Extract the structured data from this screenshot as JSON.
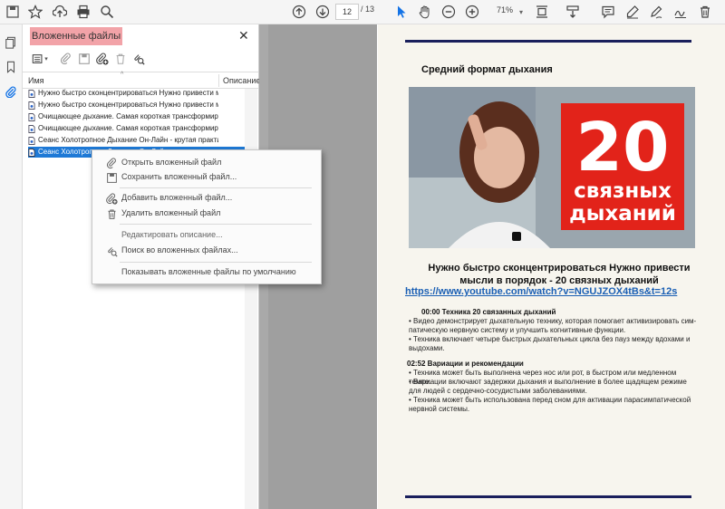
{
  "toolbar": {
    "page_current": "12",
    "page_total": "/ 13",
    "zoom": "71%",
    "icons": [
      "save-icon",
      "star-icon",
      "upload-icon",
      "print-icon",
      "zoom-search-icon",
      "prev-page-icon",
      "next-page-icon",
      "select-cursor-icon",
      "hand-icon",
      "zoom-out-icon",
      "zoom-in-icon",
      "fit-page-icon",
      "scroll-mode-icon",
      "comment-icon",
      "highlight-pen-icon",
      "draw-icon",
      "sign-icon",
      "delete-icon"
    ]
  },
  "attachments_panel": {
    "title": "Вложенные файлы",
    "col_name": "Имя",
    "col_desc": "Описание",
    "files": [
      "Нужно быстро сконцентрироваться Нужно привести мысли в порядок",
      "Нужно быстро сконцентрироваться Нужно привести мысли в порядок",
      "Очищающее дыхание. Самая короткая трансформирующая практика",
      "Очищающее дыхание. Самая короткая трансформирующая практика",
      "Сеанс Холотропное Дыхание Он-Лайн - крутая практика",
      "Сеанс Холотропное Дыхание Он-Лайн - крутая практика"
    ],
    "selected_index": 5
  },
  "context_menu": {
    "items": [
      {
        "label": "Открыть вложенный файл",
        "icon": "open-attachment-icon",
        "enabled": true
      },
      {
        "label": "Сохранить вложенный файл...",
        "icon": "save-attachment-icon",
        "enabled": true
      },
      {
        "label": "Добавить вложенный файл...",
        "icon": "add-attachment-icon",
        "enabled": true
      },
      {
        "label": "Удалить вложенный файл",
        "icon": "trash-icon",
        "enabled": true
      },
      {
        "label": "Редактировать описание...",
        "icon": "",
        "enabled": false
      },
      {
        "label": "Поиск во вложенных файлах...",
        "icon": "search-attachment-icon",
        "enabled": true
      },
      {
        "label": "Показывать вложенные файлы по умолчанию",
        "icon": "",
        "enabled": true
      }
    ]
  },
  "document": {
    "heading": "Средний формат дыхания",
    "video_text_1": "20",
    "video_text_2": "связных",
    "video_text_3": "дыханий",
    "title_line1": "Нужно быстро сконцентрироваться Нужно привести",
    "title_line2": "мысли в порядок -  20 связных дыханий",
    "link": "https://www.youtube.com/watch?v=NGUJZOX4tBs&t=12s",
    "section1": "00:00 Техника 20 связанных дыханий",
    "section1_bullets": [
      "• Видео демонстрирует дыхательную технику, которая помогает активизировать сим-патическую нервную систему и улучшить когнитивные функции.",
      "• Техника включает четыре быстрых дыхательных цикла без пауз между вдохами и выдохами."
    ],
    "section2": "02:52 Вариации и рекомендации",
    "section2_bullets": [
      "• Техника может быть выполнена через нос или рот, в быстром или медленном темпе.",
      "• Вариации включают задержки дыхания и выполнение в более щадящем режиме для людей с сердечно-сосудистыми заболеваниями.",
      "• Техника может быть использована перед сном для активации парасимпатической нервной системы."
    ]
  }
}
